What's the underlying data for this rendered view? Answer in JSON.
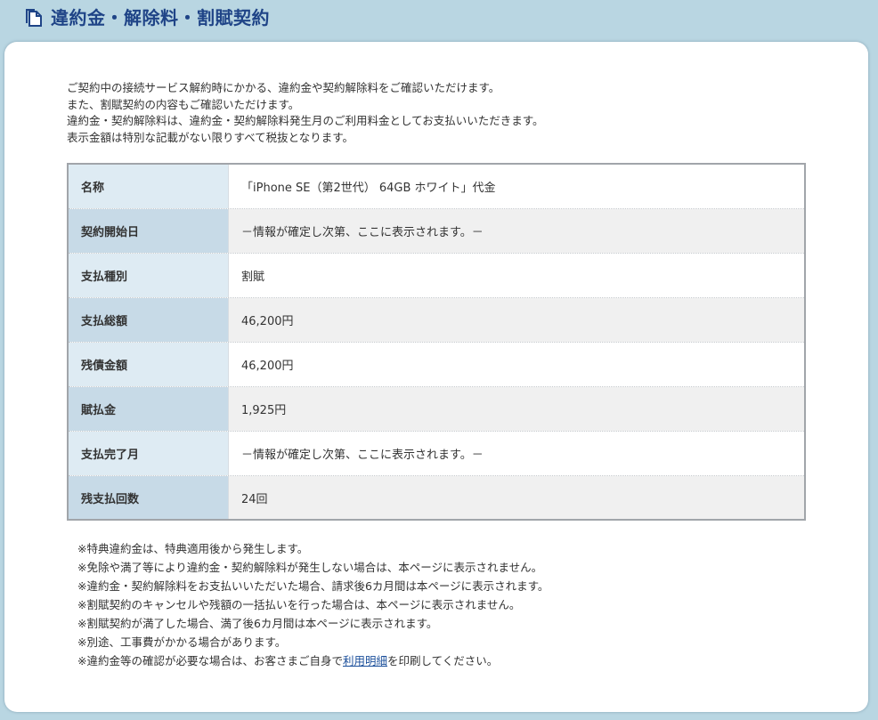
{
  "header": {
    "title": "違約金・解除料・割賦契約",
    "icon": "document-copy-icon"
  },
  "intro": [
    "ご契約中の接続サービス解約時にかかる、違約金や契約解除料をご確認いただけます。",
    "また、割賦契約の内容もご確認いただけます。",
    "違約金・契約解除料は、違約金・契約解除料発生月のご利用料金としてお支払いいただきます。",
    "表示金額は特別な記載がない限りすべて税抜となります。"
  ],
  "table": {
    "rows": [
      {
        "label": "名称",
        "value": "「iPhone SE（第2世代） 64GB ホワイト」代金"
      },
      {
        "label": "契約開始日",
        "value": "－情報が確定し次第、ここに表示されます。－"
      },
      {
        "label": "支払種別",
        "value": "割賦"
      },
      {
        "label": "支払総額",
        "value": "46,200円"
      },
      {
        "label": "残債金額",
        "value": "46,200円"
      },
      {
        "label": "賦払金",
        "value": "1,925円"
      },
      {
        "label": "支払完了月",
        "value": "－情報が確定し次第、ここに表示されます。－"
      },
      {
        "label": "残支払回数",
        "value": "24回"
      }
    ]
  },
  "notes": {
    "items": [
      "※特典違約金は、特典適用後から発生します。",
      "※免除や満了等により違約金・契約解除料が発生しない場合は、本ページに表示されません。",
      "※違約金・契約解除料をお支払いいただいた場合、請求後6カ月間は本ページに表示されます。",
      "※割賦契約のキャンセルや残額の一括払いを行った場合は、本ページに表示されません。",
      "※割賦契約が満了した場合、満了後6カ月間は本ページに表示されます。",
      "※別途、工事費がかかる場合があります。"
    ],
    "last_prefix": "※違約金等の確認が必要な場合は、お客さまご自身で",
    "last_link": "利用明細",
    "last_suffix": "を印刷してください。"
  },
  "colors": {
    "background": "#b9d6e2",
    "title": "#1f4487",
    "label_cell": "#deebf3",
    "label_cell_alt": "#c7dae7",
    "value_cell_alt": "#f0f0f0",
    "link": "#1a4e9a"
  }
}
